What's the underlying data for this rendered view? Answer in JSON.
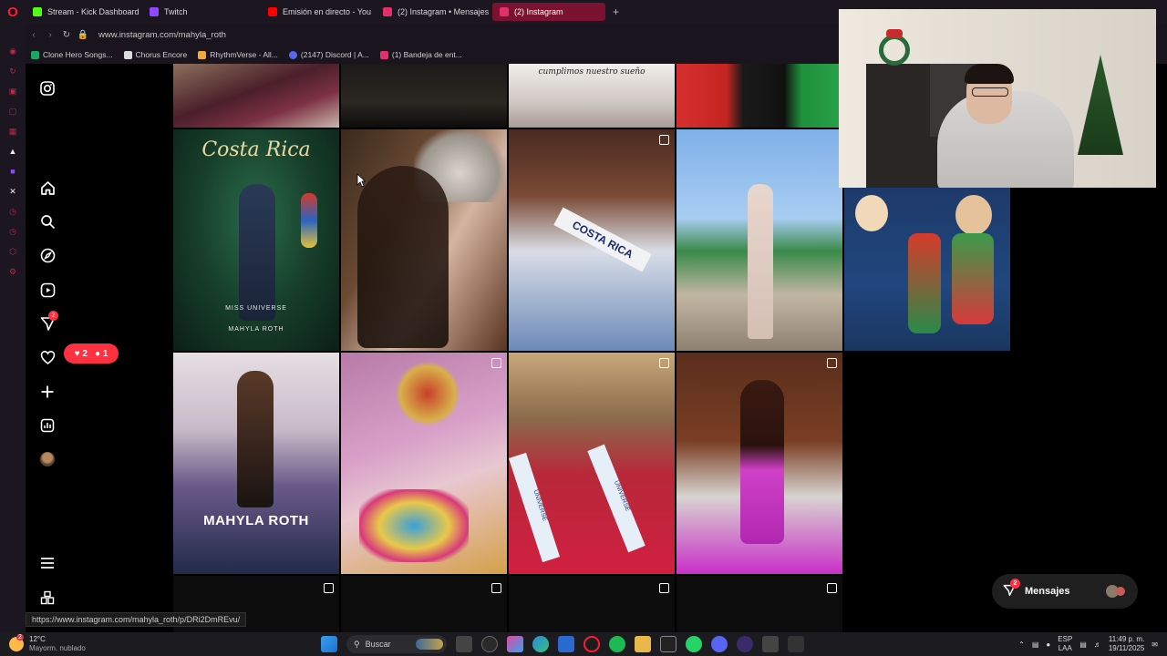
{
  "browser": {
    "tabs": [
      {
        "label": "Stream - Kick Dashboard",
        "color": "#53fc18"
      },
      {
        "label": "Twitch",
        "color": "#9146ff"
      },
      {
        "label": "Emisión en directo - You",
        "color": "#ff0000"
      },
      {
        "label": "(2) Instagram • Mensajes",
        "color": "#e1306c"
      },
      {
        "label": "(2) Instagram",
        "color": "#e1306c"
      }
    ],
    "url": "www.instagram.com/mahyla_roth",
    "bookmarks": [
      {
        "label": "Clone Hero Songs...",
        "color": "#21a366"
      },
      {
        "label": "Chorus Encore",
        "color": "#dddddd"
      },
      {
        "label": "RhythmVerse - All...",
        "color": "#f2a93b"
      },
      {
        "label": "(2147) Discord | A...",
        "color": "#5865f2"
      },
      {
        "label": "(1) Bandeja de ent...",
        "color": "#e1306c"
      }
    ]
  },
  "ig_nav": {
    "notif_badge": "2",
    "likes_count": "2",
    "followers_count": "1"
  },
  "grid": {
    "tile_captions": {
      "costa_rica": "Costa Rica",
      "miss_universe": "MISS UNIVERSE",
      "mahyla": "MAHYLA ROTH",
      "cumpliamos": "cumplimos nuestro sueño",
      "sash": "COSTA RICA",
      "universe1": "UNIVERSE",
      "universe2": "UNIVERSE"
    }
  },
  "messages": {
    "label": "Mensajes",
    "badge": "2"
  },
  "status_url": "https://www.instagram.com/mahyla_roth/p/DRi2DmREvu/",
  "taskbar": {
    "weather_temp": "12°C",
    "weather_desc": "Mayorm. nublado",
    "weather_badge": "2",
    "search_placeholder": "Buscar",
    "lang": "ESP",
    "lang2": "LAA",
    "time": "11:49 p. m.",
    "date": "19/11/2025"
  }
}
